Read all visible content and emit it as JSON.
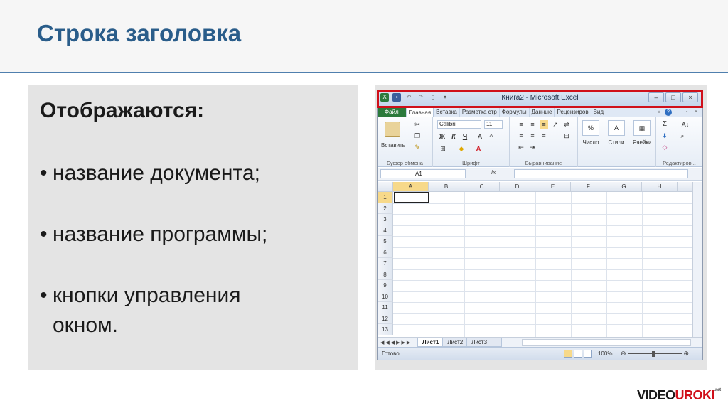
{
  "slide": {
    "title": "Строка заголовка",
    "heading": "Отображаются:",
    "bullets": [
      "название документа;",
      "название программы;",
      "кнопки управления",
      "окном."
    ]
  },
  "excel": {
    "window_title": "Книга2 - Microsoft Excel",
    "window_buttons": [
      "–",
      "□",
      "×"
    ],
    "tabs": [
      "Файл",
      "Главная",
      "Вставка",
      "Разметка стр",
      "Формулы",
      "Данные",
      "Рецензиров",
      "Вид"
    ],
    "ribbon": {
      "paste_label": "Вставить",
      "font_name": "Calibri",
      "font_size": "11",
      "bold": "Ж",
      "italic": "К",
      "underline": "Ч",
      "number_label": "Число",
      "styles_label": "Стили",
      "cells_label": "Ячейки",
      "sigma": "Σ",
      "percent": "%",
      "groups": [
        "Буфер обмена",
        "Шрифт",
        "Выравнивание",
        "Редактиров..."
      ]
    },
    "name_box": "A1",
    "fx": "fx",
    "columns": [
      "A",
      "B",
      "C",
      "D",
      "E",
      "F",
      "G",
      "H"
    ],
    "rows": [
      "1",
      "2",
      "3",
      "4",
      "5",
      "6",
      "7",
      "8",
      "9",
      "10",
      "11",
      "12",
      "13"
    ],
    "sheets": [
      "Лист1",
      "Лист2",
      "Лист3"
    ],
    "status": "Готово",
    "zoom": "100%"
  },
  "brand": {
    "part1": "VIDEO",
    "part2": "UROKI",
    "suffix": ".net"
  },
  "colors": {
    "title": "#2a5d8a",
    "highlight_outline": "#d0101a",
    "file_tab": "#2b7a3c"
  }
}
